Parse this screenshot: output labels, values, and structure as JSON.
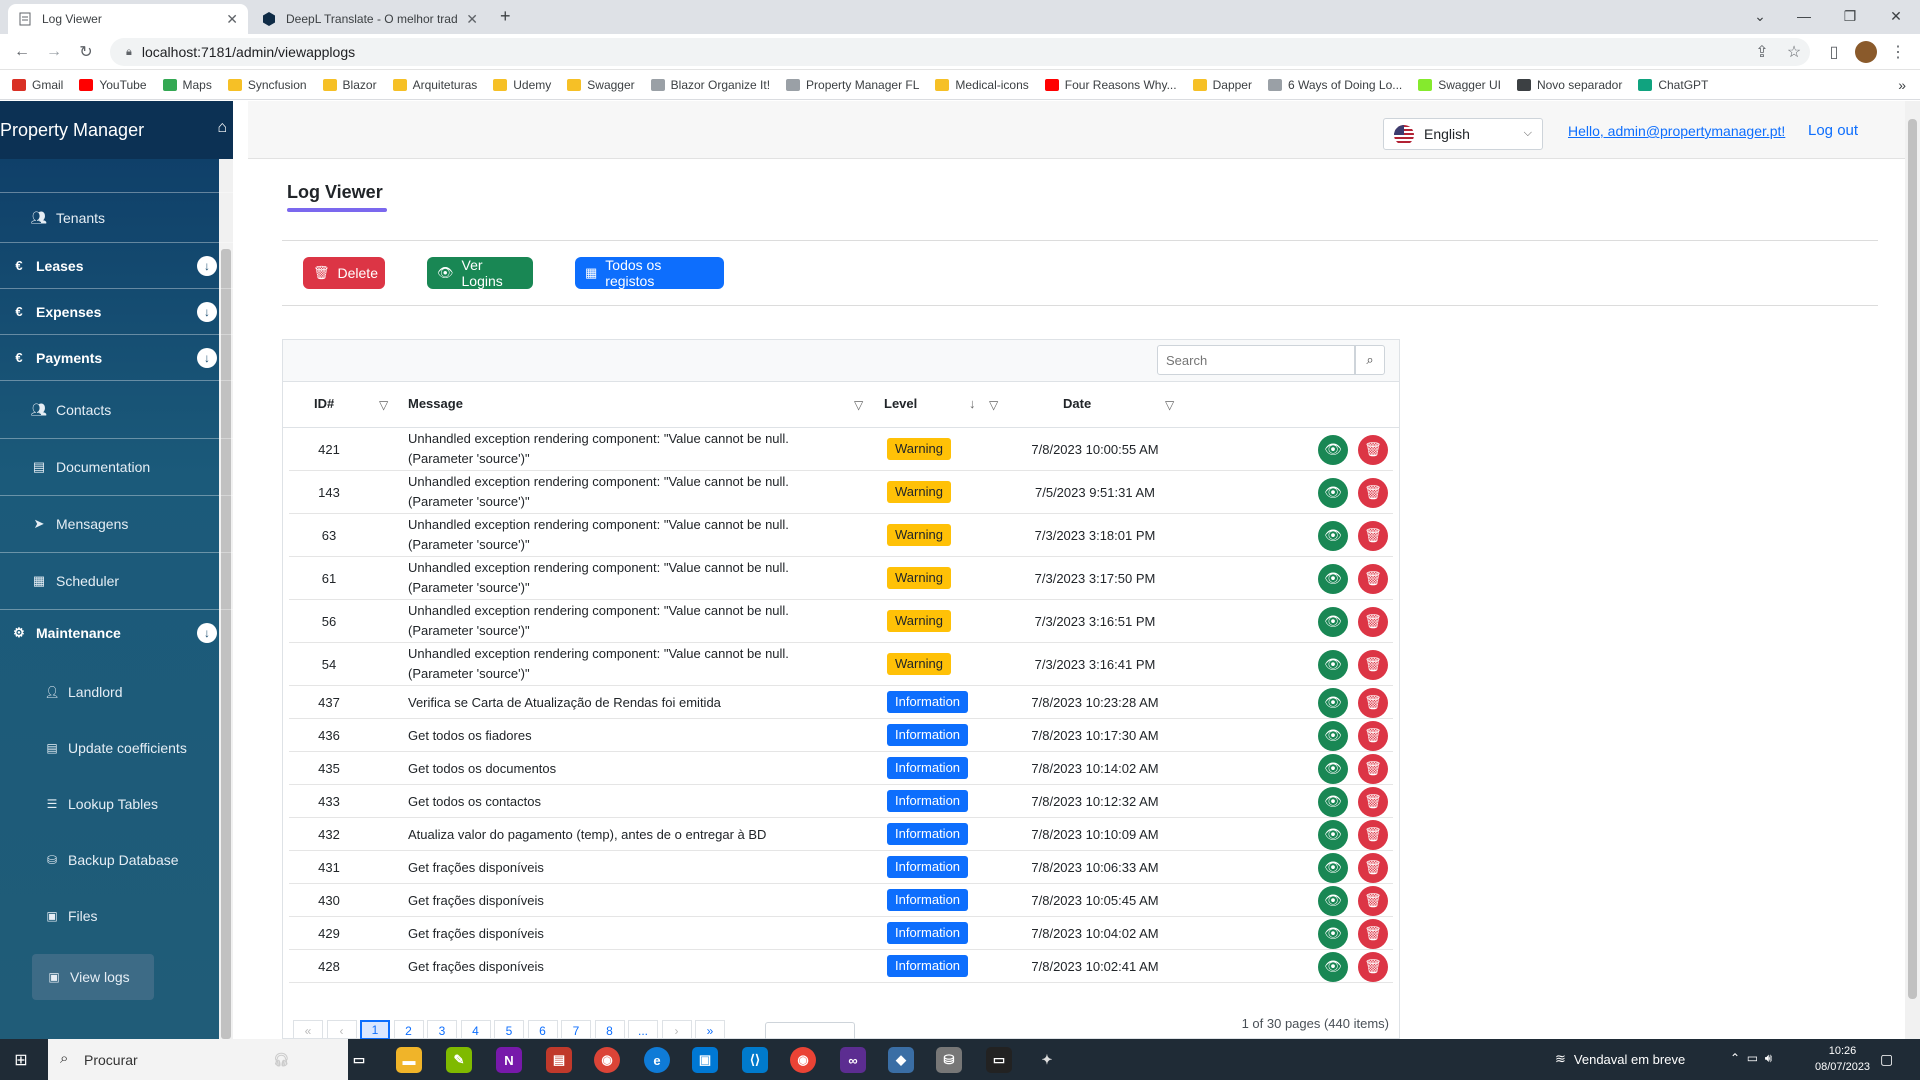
{
  "browser": {
    "tabs": [
      {
        "title": "Log Viewer",
        "active": true
      },
      {
        "title": "DeepL Translate - O melhor trad",
        "active": false
      }
    ],
    "new_tab": "+",
    "url": "localhost:7181/admin/viewapplogs",
    "bookmarks": [
      {
        "label": "Gmail",
        "color": "#d93025"
      },
      {
        "label": "YouTube",
        "color": "#ff0000"
      },
      {
        "label": "Maps",
        "color": "#34a853"
      },
      {
        "label": "Syncfusion",
        "color": "#f6c026"
      },
      {
        "label": "Blazor",
        "color": "#f6c026"
      },
      {
        "label": "Arquiteturas",
        "color": "#f6c026"
      },
      {
        "label": "Udemy",
        "color": "#f6c026"
      },
      {
        "label": "Swagger",
        "color": "#f6c026"
      },
      {
        "label": "Blazor Organize It!",
        "color": "#9aa0a6"
      },
      {
        "label": "Property Manager FL",
        "color": "#9aa0a6"
      },
      {
        "label": "Medical-icons",
        "color": "#f6c026"
      },
      {
        "label": "Four Reasons Why...",
        "color": "#ff0000"
      },
      {
        "label": "Dapper",
        "color": "#f6c026"
      },
      {
        "label": "6 Ways of Doing Lo...",
        "color": "#9aa0a6"
      },
      {
        "label": "Swagger UI",
        "color": "#85ea2d"
      },
      {
        "label": "Novo separador",
        "color": "#3c4043"
      },
      {
        "label": "ChatGPT",
        "color": "#10a37f"
      }
    ]
  },
  "sidebar": {
    "brand": "Property Manager",
    "items": [
      {
        "label": "Tenants",
        "icon": "users-icon",
        "type": "sub"
      },
      {
        "label": "Leases",
        "icon": "euro-icon",
        "type": "group"
      },
      {
        "label": "Expenses",
        "icon": "euro-icon",
        "type": "group"
      },
      {
        "label": "Payments",
        "icon": "euro-icon",
        "type": "group"
      },
      {
        "label": "Contacts",
        "icon": "users-icon",
        "type": "sub"
      },
      {
        "label": "Documentation",
        "icon": "file-icon",
        "type": "sub"
      },
      {
        "label": "Mensagens",
        "icon": "send-icon",
        "type": "sub"
      },
      {
        "label": "Scheduler",
        "icon": "calendar-icon",
        "type": "sub"
      },
      {
        "label": "Maintenance",
        "icon": "gear-icon",
        "type": "group"
      }
    ],
    "maintenance_items": [
      {
        "label": "Landlord",
        "icon": "user-icon"
      },
      {
        "label": "Update coefficients",
        "icon": "file-icon"
      },
      {
        "label": "Lookup Tables",
        "icon": "table-icon"
      },
      {
        "label": "Backup Database",
        "icon": "database-icon"
      },
      {
        "label": "Files",
        "icon": "image-icon"
      },
      {
        "label": "View logs",
        "icon": "image-icon",
        "active": true
      }
    ]
  },
  "topbar": {
    "language": "English",
    "hello": "Hello, admin@propertymanager.pt!",
    "logout": "Log out"
  },
  "page": {
    "title": "Log Viewer",
    "buttons": {
      "delete": "Delete",
      "logins": "Ver Logins",
      "all": "Todos os registos"
    }
  },
  "grid": {
    "search_placeholder": "Search",
    "columns": {
      "id": "ID#",
      "message": "Message",
      "level": "Level",
      "date": "Date"
    },
    "rows": [
      {
        "id": "421",
        "message": "Unhandled exception rendering component: \"Value cannot be null. (Parameter 'source')\"",
        "level": "Warning",
        "date": "7/8/2023 10:00:55 AM"
      },
      {
        "id": "143",
        "message": "Unhandled exception rendering component: \"Value cannot be null. (Parameter 'source')\"",
        "level": "Warning",
        "date": "7/5/2023 9:51:31 AM"
      },
      {
        "id": "63",
        "message": "Unhandled exception rendering component: \"Value cannot be null. (Parameter 'source')\"",
        "level": "Warning",
        "date": "7/3/2023 3:18:01 PM"
      },
      {
        "id": "61",
        "message": "Unhandled exception rendering component: \"Value cannot be null. (Parameter 'source')\"",
        "level": "Warning",
        "date": "7/3/2023 3:17:50 PM"
      },
      {
        "id": "56",
        "message": "Unhandled exception rendering component: \"Value cannot be null. (Parameter 'source')\"",
        "level": "Warning",
        "date": "7/3/2023 3:16:51 PM"
      },
      {
        "id": "54",
        "message": "Unhandled exception rendering component: \"Value cannot be null. (Parameter 'source')\"",
        "level": "Warning",
        "date": "7/3/2023 3:16:41 PM"
      },
      {
        "id": "437",
        "message": "Verifica se Carta de Atualização de Rendas foi emitida",
        "level": "Information",
        "date": "7/8/2023 10:23:28 AM"
      },
      {
        "id": "436",
        "message": "Get todos os fiadores",
        "level": "Information",
        "date": "7/8/2023 10:17:30 AM"
      },
      {
        "id": "435",
        "message": "Get todos os documentos",
        "level": "Information",
        "date": "7/8/2023 10:14:02 AM"
      },
      {
        "id": "433",
        "message": "Get todos os contactos",
        "level": "Information",
        "date": "7/8/2023 10:12:32 AM"
      },
      {
        "id": "432",
        "message": "Atualiza valor do pagamento (temp), antes de o entregar à BD",
        "level": "Information",
        "date": "7/8/2023 10:10:09 AM"
      },
      {
        "id": "431",
        "message": "Get frações disponíveis",
        "level": "Information",
        "date": "7/8/2023 10:06:33 AM"
      },
      {
        "id": "430",
        "message": "Get frações disponíveis",
        "level": "Information",
        "date": "7/8/2023 10:05:45 AM"
      },
      {
        "id": "429",
        "message": "Get frações disponíveis",
        "level": "Information",
        "date": "7/8/2023 10:04:02 AM"
      },
      {
        "id": "428",
        "message": "Get frações disponíveis",
        "level": "Information",
        "date": "7/8/2023 10:02:41 AM"
      }
    ],
    "pager": {
      "first": "«",
      "prev": "‹",
      "pages": [
        "1",
        "2",
        "3",
        "4",
        "5",
        "6",
        "7",
        "8",
        "..."
      ],
      "next": "›",
      "last": "»",
      "current": "1",
      "info": "1 of 30 pages (440 items)"
    }
  },
  "taskbar": {
    "search": "Procurar",
    "weather": "Vendaval em breve",
    "time": "10:26",
    "date": "08/07/2023"
  },
  "colors": {
    "warning": "#ffc107",
    "information": "#0d6efd",
    "danger": "#dc3545",
    "success": "#198754",
    "primary": "#0d6efd",
    "sidebar": "#0d3b66"
  }
}
